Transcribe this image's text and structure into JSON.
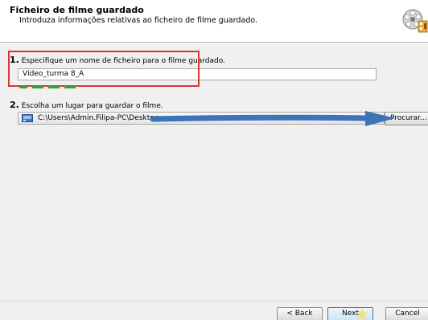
{
  "header": {
    "title": "Ficheiro de filme guardado",
    "subtitle": "Introduza informações relativas ao ficheiro de filme guardado."
  },
  "step1": {
    "number": "1.",
    "label": "Especifique um nome de ficheiro para o filme guardado.",
    "value": "Vídeo_turma 8_A"
  },
  "step2": {
    "number": "2.",
    "label": "Escolha um lugar para guardar o filme.",
    "path": "C:\\Users\\Admin.Filipa-PC\\Desktop",
    "browse_label": "Procurar..."
  },
  "footer": {
    "back_label": "< Back",
    "next_label": "Next",
    "cancel_label": "Cancel"
  },
  "colors": {
    "highlight_box": "#d9382c",
    "arrow": "#3d74b8",
    "underline": "#3f9a3a"
  },
  "icons": [
    "film-reel-icon",
    "drive-icon",
    "arrow-annotation-icon",
    "sparkle-icon"
  ]
}
